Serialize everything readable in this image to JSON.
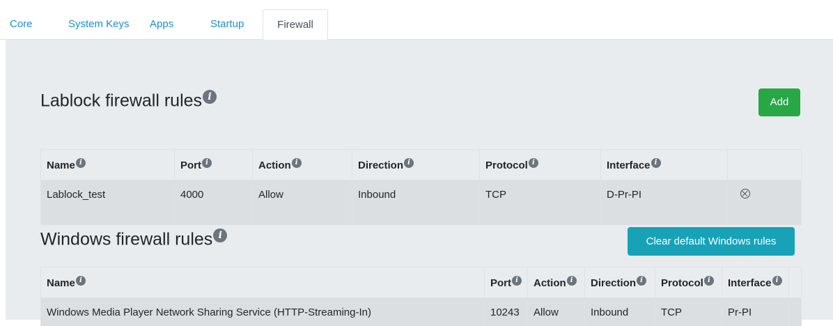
{
  "tabs": [
    {
      "label": "Core"
    },
    {
      "label": "System Keys"
    },
    {
      "label": "Apps"
    },
    {
      "label": "Startup"
    },
    {
      "label": "Firewall",
      "active": true
    }
  ],
  "lablock": {
    "title": "Lablock firewall rules",
    "add_label": "Add",
    "headers": [
      "Name",
      "Port",
      "Action",
      "Direction",
      "Protocol",
      "Interface"
    ],
    "rows": [
      {
        "name": "Lablock_test",
        "port": "4000",
        "action": "Allow",
        "direction": "Inbound",
        "protocol": "TCP",
        "interface": "D-Pr-PI"
      }
    ]
  },
  "windows": {
    "title": "Windows firewall rules",
    "clear_label": "Clear default Windows rules",
    "headers": [
      "Name",
      "Port",
      "Action",
      "Direction",
      "Protocol",
      "Interface"
    ],
    "rows": [
      {
        "name": "Windows Media Player Network Sharing Service (HTTP-Streaming-In)",
        "port": "10243",
        "action": "Allow",
        "direction": "Inbound",
        "protocol": "TCP",
        "interface": "Pr-PI"
      }
    ]
  },
  "icons": {
    "info": "info-icon",
    "remove": "remove-circle-icon"
  },
  "colors": {
    "link": "#1e8fc6",
    "add": "#28a745",
    "clear": "#17a2b8",
    "panel": "#e9ecef"
  }
}
